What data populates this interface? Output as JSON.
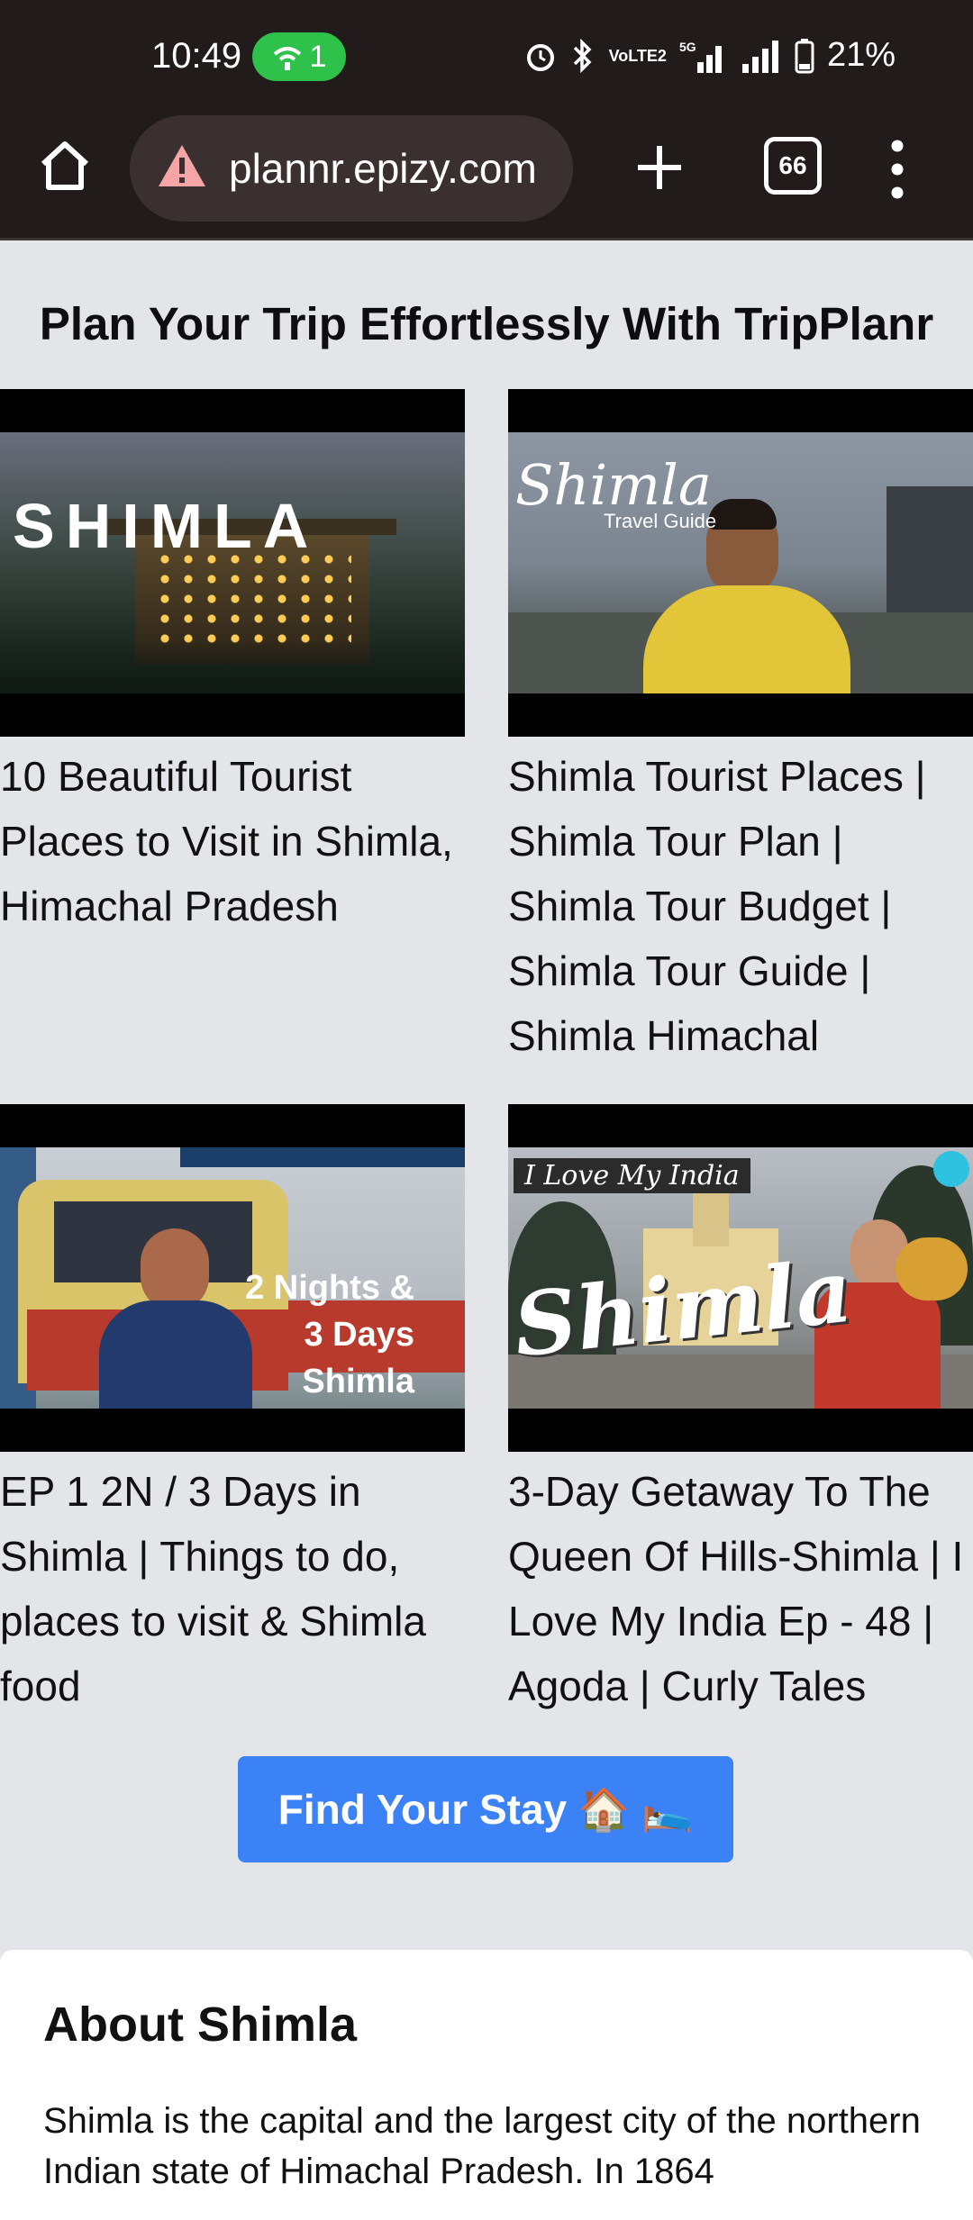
{
  "status_bar": {
    "time": "10:49",
    "hotspot_count": "1",
    "volte_label": "VoLTE2",
    "network_label": "5G",
    "battery": "21%"
  },
  "browser": {
    "url": "plannr.epizy.com",
    "tab_count": "66"
  },
  "page": {
    "title": "Plan Your Trip Effortlessly With TripPlanr"
  },
  "videos": [
    {
      "title": "10 Beautiful Tourist Places to Visit in Shimla, Himachal Pradesh",
      "overlay": "SHIMLA"
    },
    {
      "title": "Shimla Tourist Places | Shimla Tour Plan | Shimla Tour Budget | Shimla Tour Guide | Shimla Himachal",
      "overlay": "Shimla",
      "overlay_sub": "Travel Guide"
    },
    {
      "title": "EP 1 2N / 3 Days in Shimla | Things to do, places to visit & Shimla food",
      "overlay": "2 Nights & 3 Days Shimla"
    },
    {
      "title": "3-Day Getaway To The Queen Of Hills-Shimla | I Love My India Ep - 48 | Agoda | Curly Tales",
      "overlay": "Shimla",
      "overlay_tag": "I Love My India"
    }
  ],
  "cta": {
    "label": "Find Your Stay 🏠 🛌"
  },
  "about": {
    "heading": "About Shimla",
    "text": "Shimla is the capital and the largest city of the northern Indian state of Himachal Pradesh. In 1864"
  }
}
